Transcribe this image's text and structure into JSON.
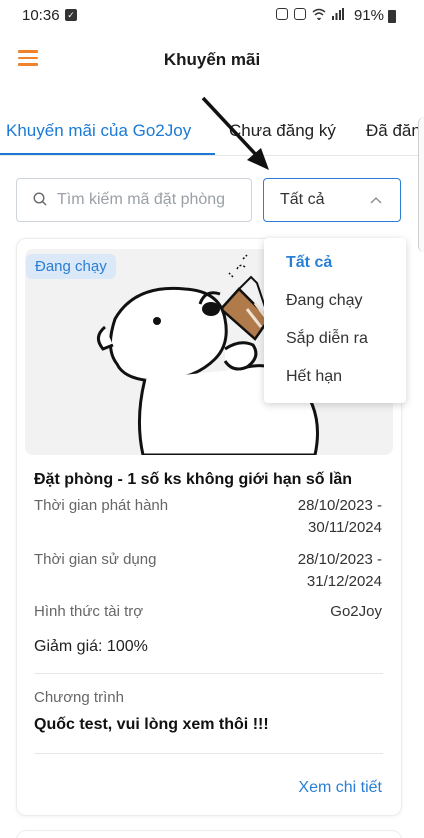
{
  "status_bar": {
    "time": "10:36",
    "battery": "91%"
  },
  "header": {
    "title": "Khuyến mãi",
    "menu_icon": "hamburger-menu-icon"
  },
  "tabs": [
    {
      "label": "Khuyến mãi của Go2Joy",
      "active": true
    },
    {
      "label": "Chưa đăng ký",
      "active": false
    },
    {
      "label": "Đã đăng",
      "active": false
    }
  ],
  "search": {
    "placeholder": "Tìm kiếm mã đặt phòng",
    "value": ""
  },
  "filter": {
    "selected": "Tất cả",
    "options": [
      "Tất cả",
      "Đang chạy",
      "Sắp diễn ra",
      "Hết hạn"
    ]
  },
  "promo_card": {
    "badge": "Đang chạy",
    "title": "Đặt phòng - 1 số ks không giới hạn số lần",
    "release_label": "Thời gian phát hành",
    "release_from": "28/10/2023 -",
    "release_to": "30/11/2024",
    "usage_label": "Thời gian sử dụng",
    "usage_from": "28/10/2023 -",
    "usage_to": "31/12/2024",
    "sponsor_label": "Hình thức tài trợ",
    "sponsor_value": "Go2Joy",
    "discount": "Giảm giá: 100%",
    "program_label": "Chương trình",
    "program_name": "Quốc test, vui lòng xem thôi !!!",
    "detail_link": "Xem chi tiết"
  },
  "colors": {
    "accent": "#2a7fd4",
    "menu": "#f0822b",
    "badge_bg": "#dbe8f8"
  }
}
